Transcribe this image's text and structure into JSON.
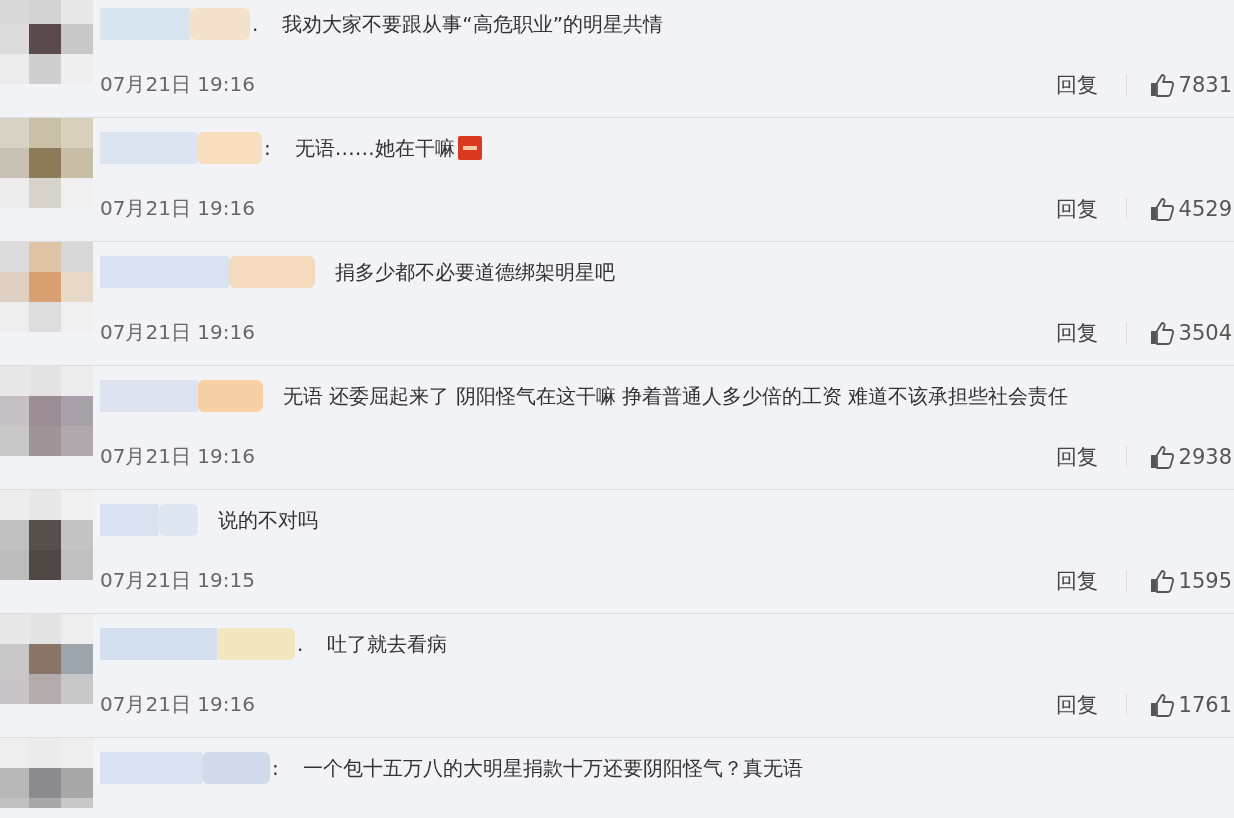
{
  "comments": [
    {
      "separator": ".",
      "text": "我劝大家不要跟从事“高危职业”的明星共情",
      "has_emoji": false,
      "time": "07月21日 19:16",
      "reply": "回复",
      "likes": "7831"
    },
    {
      "separator": ":",
      "text": "无语……她在干嘛",
      "has_emoji": true,
      "time": "07月21日 19:16",
      "reply": "回复",
      "likes": "4529"
    },
    {
      "text": "捐多少都不必要道德绑架明星吧",
      "has_emoji": false,
      "time": "07月21日 19:16",
      "reply": "回复",
      "likes": "3504"
    },
    {
      "text": "无语 还委屈起来了 阴阳怪气在这干嘛 挣着普通人多少倍的工资 难道不该承担些社会责任",
      "has_emoji": false,
      "time": "07月21日 19:16",
      "reply": "回复",
      "likes": "2938"
    },
    {
      "text": "说的不对吗",
      "has_emoji": false,
      "time": "07月21日 19:15",
      "reply": "回复",
      "likes": "1595"
    },
    {
      "separator": ".",
      "text": "吐了就去看病",
      "has_emoji": false,
      "time": "07月21日 19:16",
      "reply": "回复",
      "likes": "1761"
    },
    {
      "separator": ":",
      "text": "一个包十五万八的大明星捐款十万还要阴阳怪气？真无语",
      "has_emoji": false
    }
  ]
}
